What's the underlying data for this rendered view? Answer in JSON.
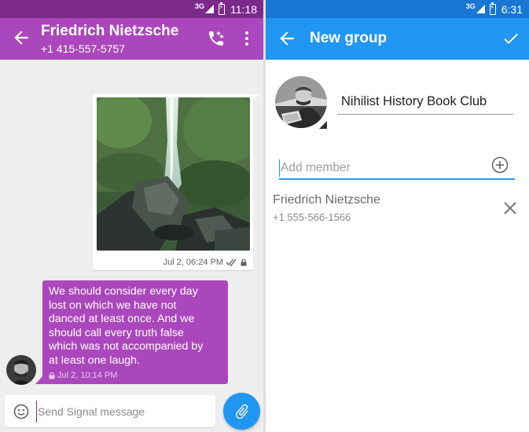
{
  "left_screen": {
    "status_bar": {
      "network": "3G",
      "time": "11:18"
    },
    "toolbar": {
      "contact_name": "Friedrich Nietzsche",
      "contact_phone": "+1 415-557-5757",
      "back_icon": "arrow-back-icon",
      "call_icon": "phone-icon",
      "menu_icon": "more-vert-icon"
    },
    "messages": [
      {
        "type": "image",
        "direction": "outgoing",
        "timestamp": "Jul 2, 06:24 PM",
        "status_icons": [
          "double-check-icon",
          "lock-icon"
        ]
      },
      {
        "type": "text",
        "direction": "incoming",
        "text": "We should consider every day\nlost on which we have not\ndanced at least once. And we\nshould call every truth false\nwhich was not accompanied by\nat least one laugh.",
        "timestamp": "Jul 2, 10:14 PM",
        "status_icons": [
          "lock-icon"
        ]
      }
    ],
    "compose": {
      "placeholder": "Send Signal message",
      "emoji_icon": "emoji-icon",
      "attach_icon": "paperclip-icon"
    },
    "colors": {
      "status_bar": "#7b2a8c",
      "toolbar": "#ab47bc",
      "incoming_bubble": "#ab47bc",
      "fab": "#2196f3"
    }
  },
  "right_screen": {
    "status_bar": {
      "network": "3G",
      "time": "6:31"
    },
    "toolbar": {
      "title": "New group",
      "back_icon": "arrow-back-icon",
      "confirm_icon": "check-icon"
    },
    "group_name": "Nihilist History Book Club",
    "add_member": {
      "placeholder": "Add member",
      "icon": "add-circle-icon"
    },
    "members": [
      {
        "name": "Friedrich Nietzsche",
        "phone": "+1 555-566-1566",
        "remove_icon": "close-icon"
      }
    ],
    "colors": {
      "status_bar": "#1976d2",
      "toolbar": "#2196f3"
    }
  }
}
